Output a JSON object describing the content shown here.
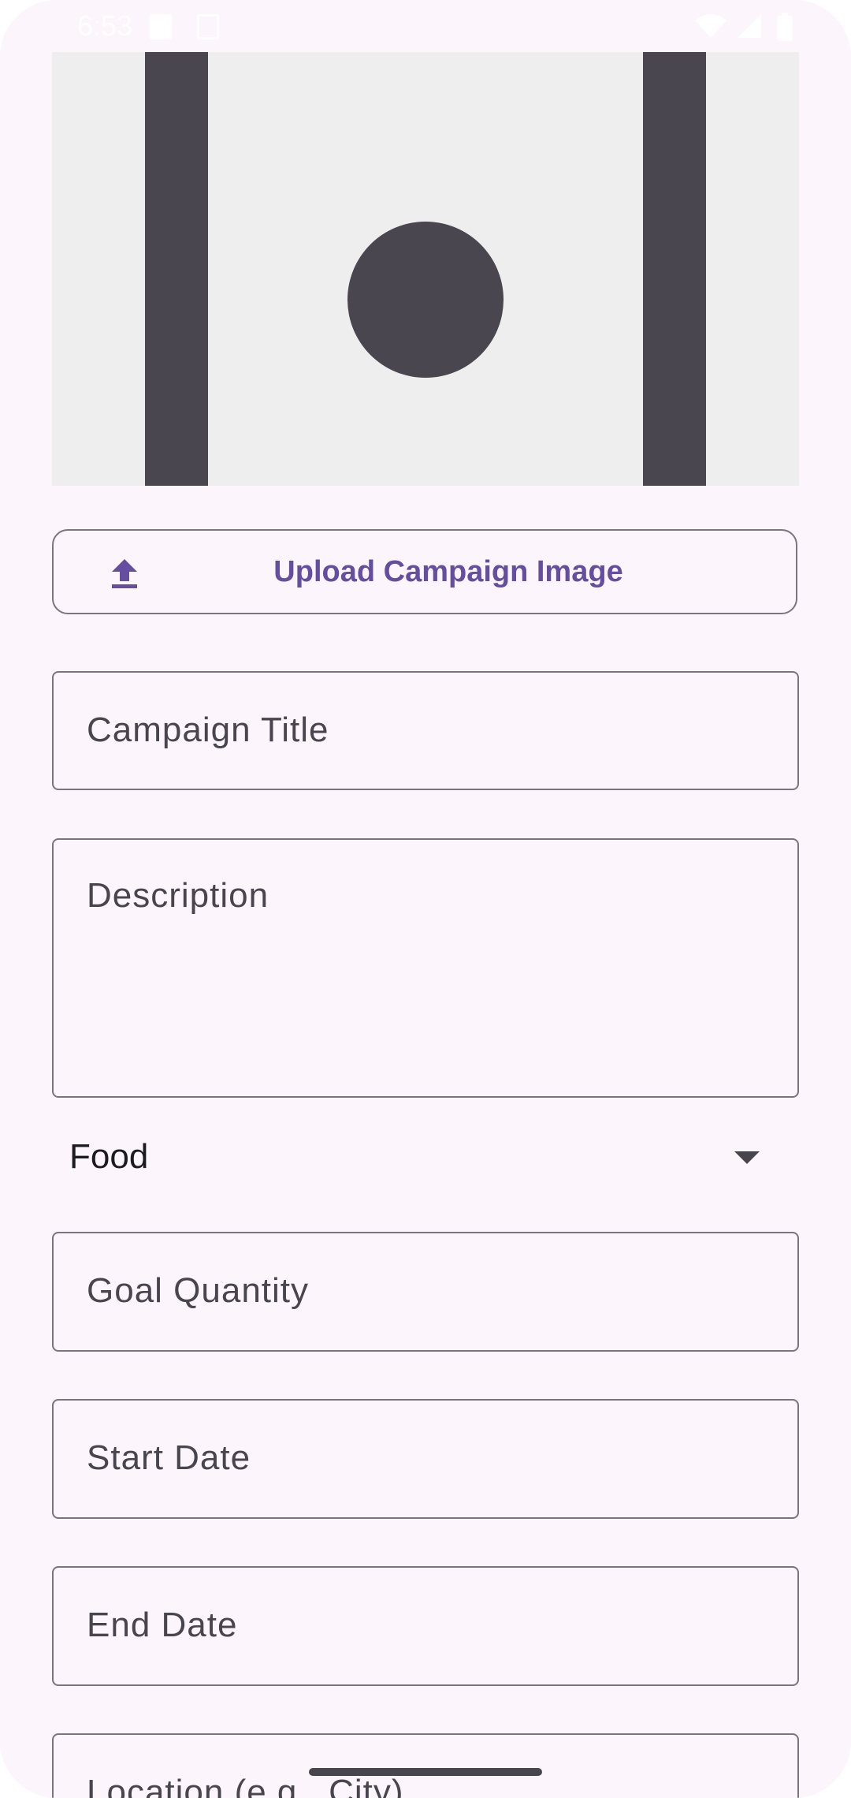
{
  "status_bar": {
    "time": "6:53"
  },
  "upload": {
    "label": "Upload Campaign Image",
    "icon": "upload-icon"
  },
  "fields": {
    "title_label": "Campaign Title",
    "description_label": "Description",
    "goal_label": "Goal Quantity",
    "start_label": "Start Date",
    "end_label": "End Date",
    "location_label": "Location (e.g., City)"
  },
  "category": {
    "selected": "Food"
  },
  "colors": {
    "background": "#fcf5fc",
    "accent": "#654e9f",
    "outline": "#79747e",
    "placeholder_shape": "#49464f"
  }
}
